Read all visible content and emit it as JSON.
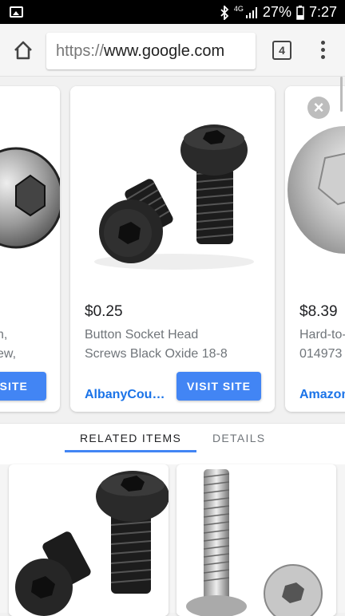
{
  "status": {
    "battery_percent": "27%",
    "time": "7:27",
    "network_label": "4G"
  },
  "browser": {
    "url_scheme": "https://",
    "url_host": "www.google.com",
    "tab_count": "4"
  },
  "cards": [
    {
      "price": "",
      "title_line1": "n,",
      "title_line2": "ew,",
      "source": "",
      "button": "T SITE"
    },
    {
      "price": "$0.25",
      "title_line1": "Button Socket Head",
      "title_line2": "Screws Black Oxide 18-8",
      "source": "AlbanyCou…",
      "button": "VISIT SITE"
    },
    {
      "price": "$8.39",
      "title_line1": "Hard-to-",
      "title_line2": "014973",
      "source": "Amazon",
      "button": ""
    }
  ],
  "tabs": {
    "related": "RELATED ITEMS",
    "details": "DETAILS"
  },
  "colors": {
    "accent": "#4285f4",
    "link": "#1a73e8",
    "status_bar": "#000000"
  }
}
